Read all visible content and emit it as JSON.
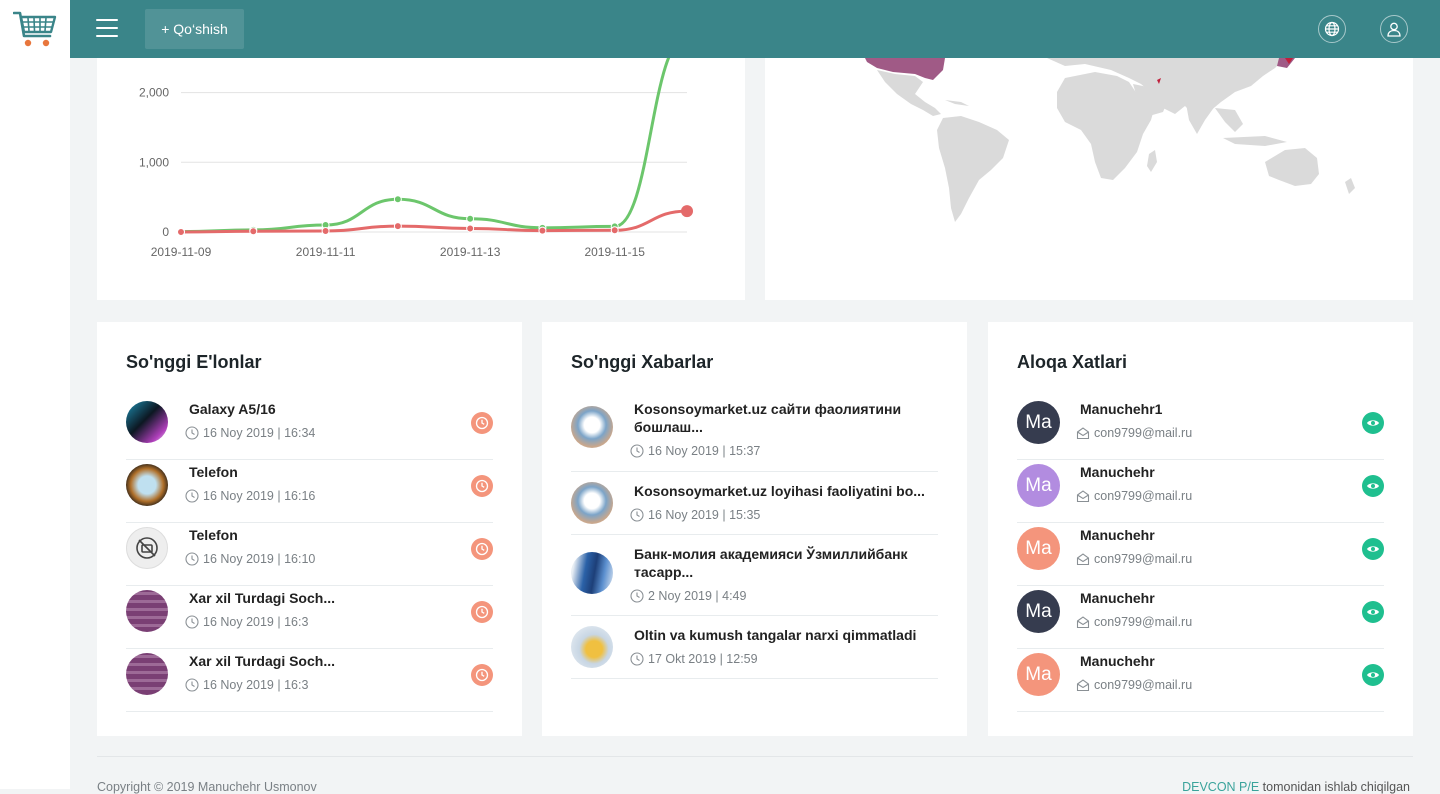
{
  "header": {
    "add_label": "+ Qo‘shish"
  },
  "chart_data": {
    "type": "line",
    "x": [
      "2019-11-09",
      "2019-11-10",
      "2019-11-11",
      "2019-11-12",
      "2019-11-13",
      "2019-11-14",
      "2019-11-15",
      "2019-11-16"
    ],
    "x_tick_labels": [
      "2019-11-09",
      "2019-11-11",
      "2019-11-13",
      "2019-11-15"
    ],
    "y_tick_labels": [
      "0",
      "1,000",
      "2,000"
    ],
    "ylim": [
      0,
      2500
    ],
    "series": [
      {
        "color": "#6cc66c",
        "values": [
          5,
          30,
          100,
          470,
          190,
          60,
          80,
          2800
        ]
      },
      {
        "color": "#e46a6a",
        "values": [
          0,
          10,
          15,
          85,
          50,
          20,
          25,
          300
        ]
      }
    ],
    "grid": true
  },
  "ads": {
    "title": "So'nggi E'lonlar",
    "items": [
      {
        "title": "Galaxy A5/16",
        "date": "16 Noy 2019 | 16:34"
      },
      {
        "title": "Telefon",
        "date": "16 Noy 2019 | 16:16"
      },
      {
        "title": "Telefon",
        "date": "16 Noy 2019 | 16:10"
      },
      {
        "title": "Xar xil Turdagi Soch...",
        "date": "16 Noy 2019 | 16:3"
      },
      {
        "title": "Xar xil Turdagi Soch...",
        "date": "16 Noy 2019 | 16:3"
      }
    ]
  },
  "news": {
    "title": "So'nggi Xabarlar",
    "items": [
      {
        "title": "Kosonsoymarket.uz сайти фаолиятини бошлаш...",
        "date": "16 Noy 2019 | 15:37"
      },
      {
        "title": "Kosonsoymarket.uz loyihasi faoliyatini bo...",
        "date": "16 Noy 2019 | 15:35"
      },
      {
        "title": "Банк-молия академияси Ўзмиллийбанк тасарр...",
        "date": "2 Noy 2019 | 4:49"
      },
      {
        "title": "Oltin va kumush tangalar narxi qimmatladi",
        "date": "17 Okt 2019 | 12:59"
      }
    ]
  },
  "contacts": {
    "title": "Aloqa Xatlari",
    "items": [
      {
        "initials": "Ma",
        "name": "Manuchehr1",
        "email": "con9799@mail.ru",
        "color": "#363c4f"
      },
      {
        "initials": "Ma",
        "name": "Manuchehr",
        "email": "con9799@mail.ru",
        "color": "#b28ce0"
      },
      {
        "initials": "Ma",
        "name": "Manuchehr",
        "email": "con9799@mail.ru",
        "color": "#f4957c"
      },
      {
        "initials": "Ma",
        "name": "Manuchehr",
        "email": "con9799@mail.ru",
        "color": "#363c4f"
      },
      {
        "initials": "Ma",
        "name": "Manuchehr",
        "email": "con9799@mail.ru",
        "color": "#f4957c"
      }
    ]
  },
  "footer": {
    "copyright": "Copyright © 2019 Manuchehr Usmonov",
    "brand": "DEVCON P/E",
    "suffix": " tomonidan ishlab chiqilgan"
  }
}
